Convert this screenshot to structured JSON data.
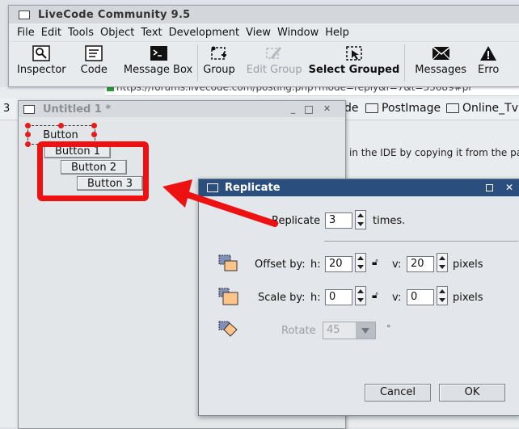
{
  "browser": {
    "url_fragment": "https://forums.livecode.com/posting.php?mode=reply&f=7&t=33689#pr",
    "bookmark_fragment_left": "3",
    "bookmark_fragment_mid": "de",
    "bookmarks": [
      "PostImage",
      "Online_Tv"
    ],
    "page_text": "in the IDE by copying it from the pal"
  },
  "ide": {
    "title": "LiveCode Community 9.5",
    "menu": [
      "File",
      "Edit",
      "Tools",
      "Object",
      "Text",
      "Development",
      "View",
      "Window",
      "Help"
    ],
    "toolbar": {
      "inspector": "Inspector",
      "code": "Code",
      "message_box": "Message Box",
      "group": "Group",
      "edit_group": "Edit Group",
      "select_grouped": "Select Grouped",
      "messages": "Messages",
      "errors": "Erro"
    }
  },
  "stack": {
    "title": "Untitled 1 *",
    "buttons": [
      "Button",
      "Button 1",
      "Button 2",
      "Button 3"
    ]
  },
  "dialog": {
    "title": "Replicate",
    "replicate_label": "Replicate",
    "replicate_value": "3",
    "times_label": "times.",
    "offset_label": "Offset by:",
    "scale_label": "Scale by:",
    "h_label": "h:",
    "v_label": "v:",
    "offset_h": "20",
    "offset_v": "20",
    "scale_h": "0",
    "scale_v": "0",
    "pixels_label": "pixels",
    "rotate_label": "Rotate",
    "rotate_value": "45",
    "degree_symbol": "°",
    "cancel": "Cancel",
    "ok": "OK"
  },
  "colors": {
    "annotation_red": "#ee1111",
    "dialog_titlebar": "#2a4f7e"
  }
}
